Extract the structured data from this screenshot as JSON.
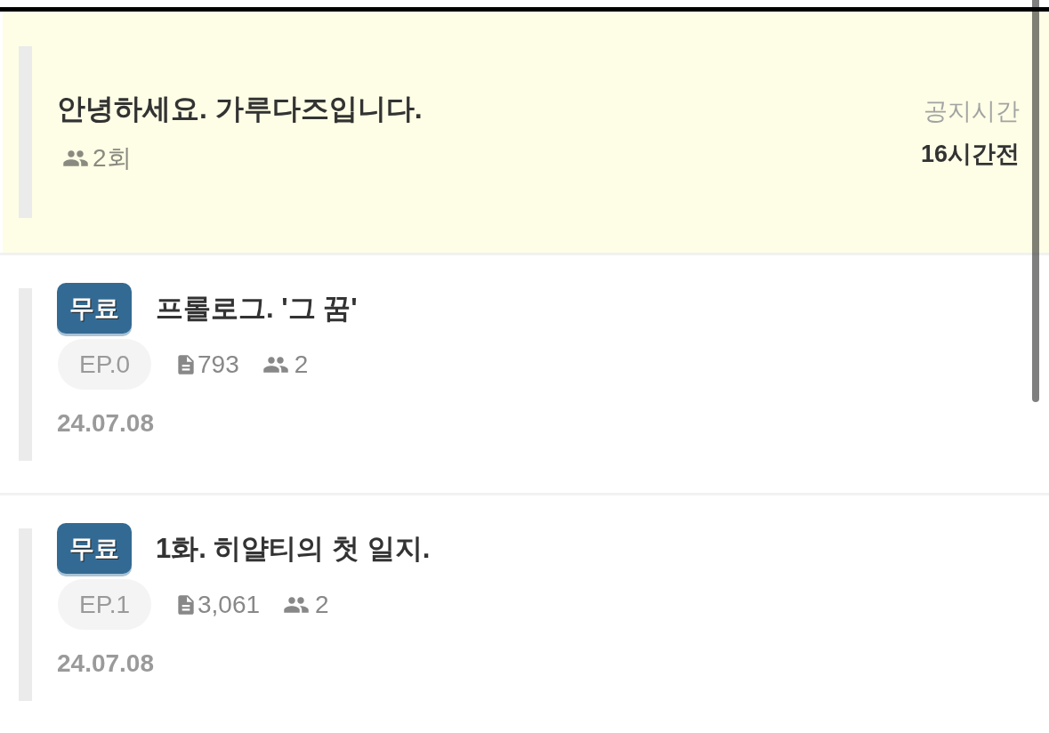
{
  "notice": {
    "title": "안녕하세요. 가루다즈입니다.",
    "views": "2회",
    "time_label": "공지시간",
    "time": "16시간전"
  },
  "episodes": [
    {
      "badge": "무료",
      "title": "프롤로그. '그 꿈'",
      "episode": "EP.0",
      "chars": "793",
      "viewers": "2",
      "date": "24.07.08"
    },
    {
      "badge": "무료",
      "title": "1화. 히얄티의 첫 일지.",
      "episode": "EP.1",
      "chars": "3,061",
      "viewers": "2",
      "date": "24.07.08"
    }
  ]
}
